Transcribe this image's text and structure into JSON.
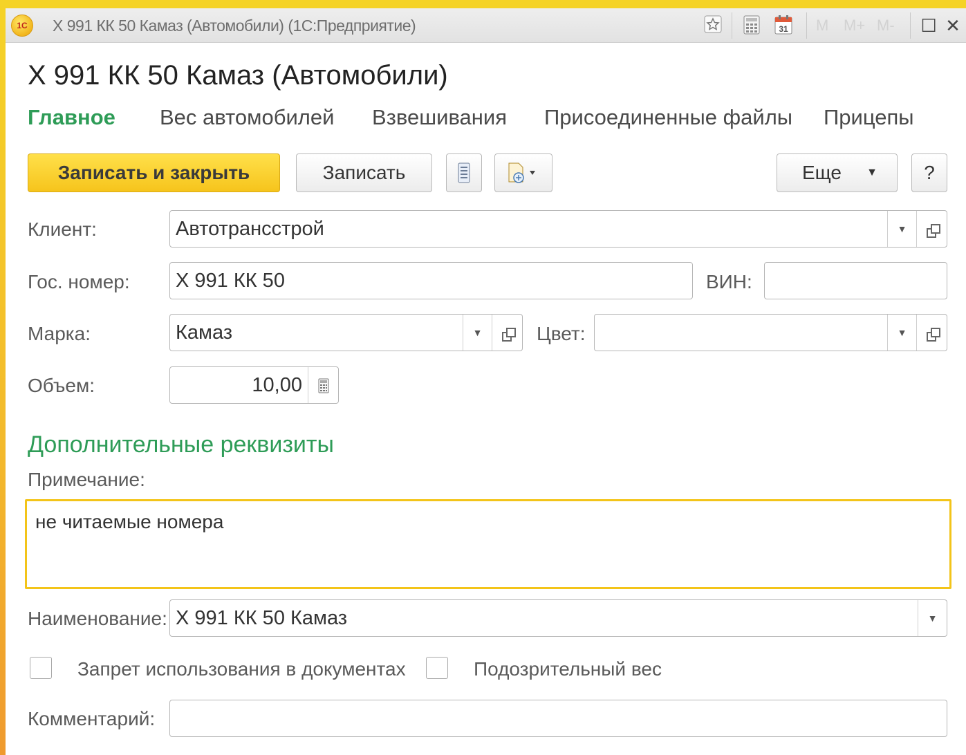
{
  "window": {
    "title": "Х 991 КК 50  Камаз (Автомобили)  (1С:Предприятие)",
    "logo_text": "1С",
    "toolbar_icons": [
      "favorite-star-icon",
      "calculator-icon",
      "calendar-icon"
    ],
    "calendar_day": "31",
    "memory_buttons": [
      "M",
      "M+",
      "M-"
    ],
    "maximize_glyph": "☐",
    "close_glyph": "✕"
  },
  "form": {
    "title": "Х 991 КК 50  Камаз (Автомобили)",
    "tabs": [
      {
        "label": "Главное",
        "active": true
      },
      {
        "label": "Вес автомобилей",
        "active": false
      },
      {
        "label": "Взвешивания",
        "active": false
      },
      {
        "label": "Присоединенные файлы",
        "active": false
      },
      {
        "label": "Прицепы",
        "active": false
      }
    ],
    "buttons": {
      "save_close": "Записать и закрыть",
      "save": "Записать",
      "more": "Еще",
      "help": "?"
    },
    "fields": {
      "client_label": "Клиент:",
      "client_value": "Автотрансстрой",
      "plate_label": "Гос. номер:",
      "plate_value": "Х 991 КК 50",
      "vin_label": "ВИН:",
      "vin_value": "",
      "brand_label": "Марка:",
      "brand_value": "Камаз",
      "color_label": "Цвет:",
      "color_value": "",
      "volume_label": "Объем:",
      "volume_value": "10,00"
    },
    "additional": {
      "section_title": "Дополнительные реквизиты",
      "note_label": "Примечание:",
      "note_value": "не читаемые номера",
      "name_label": "Наименование:",
      "name_value": "Х 991 КК 50  Камаз",
      "ban_label": "Запрет использования в документах",
      "ban_checked": false,
      "suspicious_label": "Подозрительный вес",
      "suspicious_checked": false,
      "comment_label": "Комментарий:",
      "comment_value": ""
    }
  },
  "colors": {
    "accent_green": "#2e9c57",
    "primary_button": "#f6c41c",
    "focus_border": "#f3c419"
  }
}
